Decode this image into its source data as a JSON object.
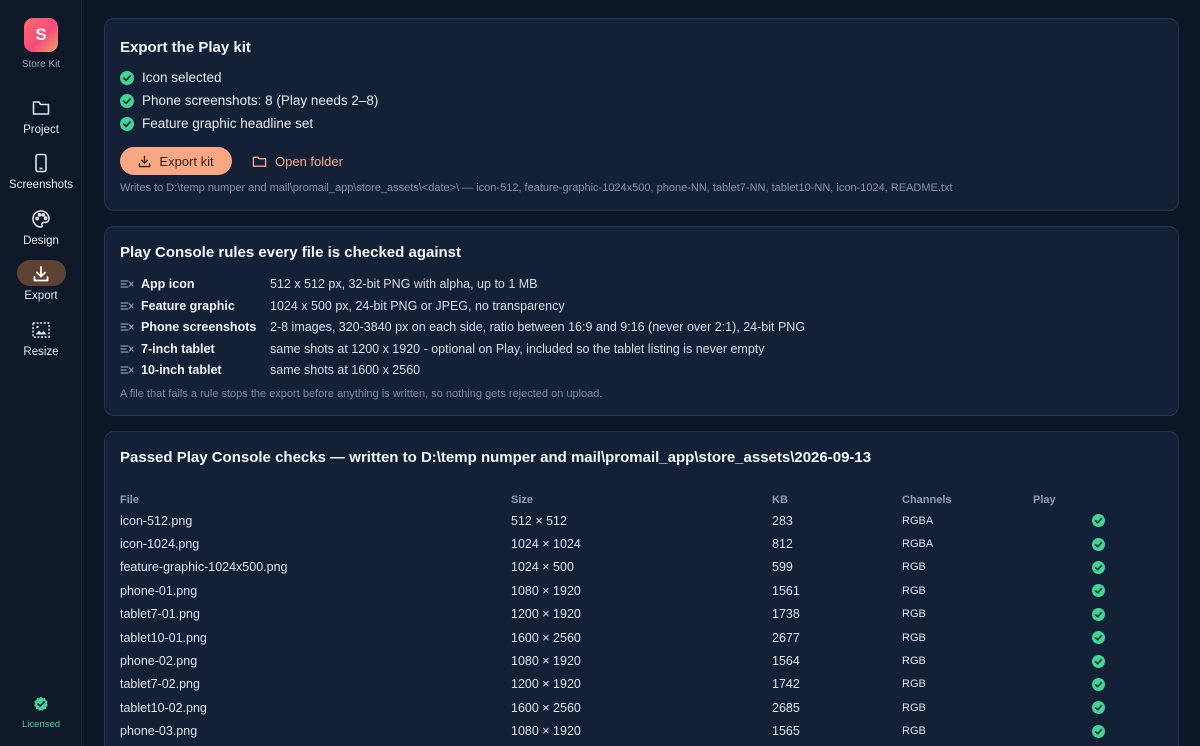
{
  "app": {
    "logo_letter": "S",
    "name": "Store Kit",
    "accent": "#f7a883",
    "success": "#3fd59b"
  },
  "sidebar": {
    "items": [
      {
        "label": "Project",
        "icon": "folder-icon"
      },
      {
        "label": "Screenshots",
        "icon": "phone-icon"
      },
      {
        "label": "Design",
        "icon": "palette-icon"
      },
      {
        "label": "Export",
        "icon": "download-icon",
        "active": true
      },
      {
        "label": "Resize",
        "icon": "resize-icon"
      }
    ],
    "licensed": "Licensed"
  },
  "export_card": {
    "title": "Export the Play kit",
    "checks": [
      "Icon selected",
      "Phone screenshots: 8 (Play needs 2–8)",
      "Feature graphic headline set"
    ],
    "export_button": "Export kit",
    "open_button": "Open folder",
    "writes_to": "Writes to  D:\\temp numper and mail\\promail_app\\store_assets\\<date>\\  — icon-512, feature-graphic-1024x500, phone-NN, tablet7-NN, tablet10-NN, icon-1024, README.txt"
  },
  "rules_card": {
    "title": "Play Console rules every file is checked against",
    "rules": [
      {
        "name": "App icon",
        "desc": "512 x 512 px, 32-bit PNG with alpha, up to 1 MB"
      },
      {
        "name": "Feature graphic",
        "desc": "1024 x 500 px, 24-bit PNG or JPEG, no transparency"
      },
      {
        "name": "Phone screenshots",
        "desc": "2-8 images, 320-3840 px on each side, ratio between 16:9 and 9:16 (never over 2:1), 24-bit PNG"
      },
      {
        "name": "7-inch tablet",
        "desc": "same shots at 1200 x 1920 - optional on Play, included so the tablet listing is never empty"
      },
      {
        "name": "10-inch tablet",
        "desc": "same shots at 1600 x 2560"
      }
    ],
    "note": "A file that fails a rule stops the export before anything is written, so nothing gets rejected on upload."
  },
  "results_card": {
    "title": "Passed Play Console checks — written to D:\\temp numper and mail\\promail_app\\store_assets\\2026-09-13",
    "columns": [
      "File",
      "Size",
      "KB",
      "Channels",
      "Play"
    ],
    "rows": [
      {
        "file": "icon-512.png",
        "size": "512 × 512",
        "kb": "283",
        "channels": "RGBA",
        "play": true
      },
      {
        "file": "icon-1024.png",
        "size": "1024 × 1024",
        "kb": "812",
        "channels": "RGBA",
        "play": true
      },
      {
        "file": "feature-graphic-1024x500.png",
        "size": "1024 × 500",
        "kb": "599",
        "channels": "RGB",
        "play": true
      },
      {
        "file": "phone-01.png",
        "size": "1080 × 1920",
        "kb": "1561",
        "channels": "RGB",
        "play": true
      },
      {
        "file": "tablet7-01.png",
        "size": "1200 × 1920",
        "kb": "1738",
        "channels": "RGB",
        "play": true
      },
      {
        "file": "tablet10-01.png",
        "size": "1600 × 2560",
        "kb": "2677",
        "channels": "RGB",
        "play": true
      },
      {
        "file": "phone-02.png",
        "size": "1080 × 1920",
        "kb": "1564",
        "channels": "RGB",
        "play": true
      },
      {
        "file": "tablet7-02.png",
        "size": "1200 × 1920",
        "kb": "1742",
        "channels": "RGB",
        "play": true
      },
      {
        "file": "tablet10-02.png",
        "size": "1600 × 2560",
        "kb": "2685",
        "channels": "RGB",
        "play": true
      },
      {
        "file": "phone-03.png",
        "size": "1080 × 1920",
        "kb": "1565",
        "channels": "RGB",
        "play": true
      }
    ]
  }
}
